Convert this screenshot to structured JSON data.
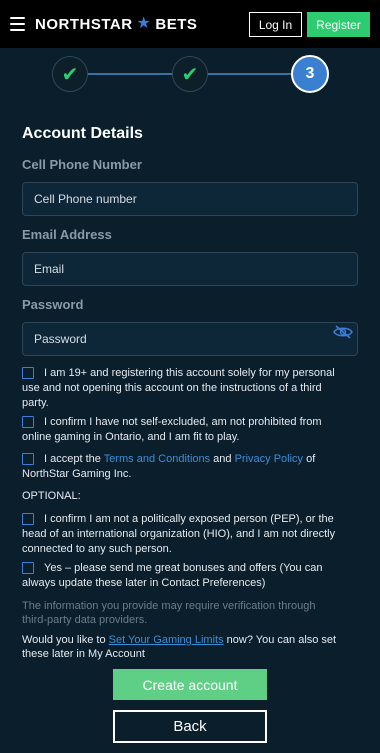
{
  "header": {
    "logo_left": "NORTHSTAR",
    "logo_star": "★",
    "logo_right": "BETS",
    "login_label": "Log In",
    "register_label": "Register"
  },
  "stepper": {
    "steps": [
      {
        "state": "done",
        "glyph": "✔"
      },
      {
        "state": "done",
        "glyph": "✔"
      },
      {
        "state": "current",
        "label": "3"
      }
    ]
  },
  "form": {
    "title": "Account Details",
    "phone": {
      "label": "Cell Phone Number",
      "placeholder": "Cell Phone number"
    },
    "email": {
      "label": "Email Address",
      "placeholder": "Email"
    },
    "password": {
      "label": "Password",
      "placeholder": "Password"
    }
  },
  "checks": {
    "age": "I am 19+ and registering this account solely for my personal use and not opening this account on the instructions of a third party.",
    "excluded": "I confirm I have not self-excluded, am not prohibited from online gaming in Ontario, and I am fit to play.",
    "terms_prefix": "I accept the ",
    "terms_link": "Terms and Conditions",
    "terms_mid": " and ",
    "privacy_link": "Privacy Policy",
    "terms_suffix": " of NorthStar Gaming Inc.",
    "optional_label": "OPTIONAL:",
    "pep": "I confirm I am not a politically exposed person (PEP), or the head of an international organization (HIO), and I am not directly connected to any such person.",
    "bonuses": "Yes – please send me great bonuses and offers (You can always update these later in Contact Preferences)"
  },
  "info": "The information you provide may require verification through third-party data providers.",
  "limits": {
    "prefix": "Would you like to ",
    "link": "Set Your Gaming Limits",
    "suffix": " now? You can also set these later in My Account"
  },
  "actions": {
    "create_label": "Create account",
    "back_label": "Back"
  },
  "colors": {
    "background": "#0a1e2c",
    "accent_green": "#2ecc71",
    "accent_blue": "#3b7dd8",
    "link_blue": "#3b8fd9"
  }
}
